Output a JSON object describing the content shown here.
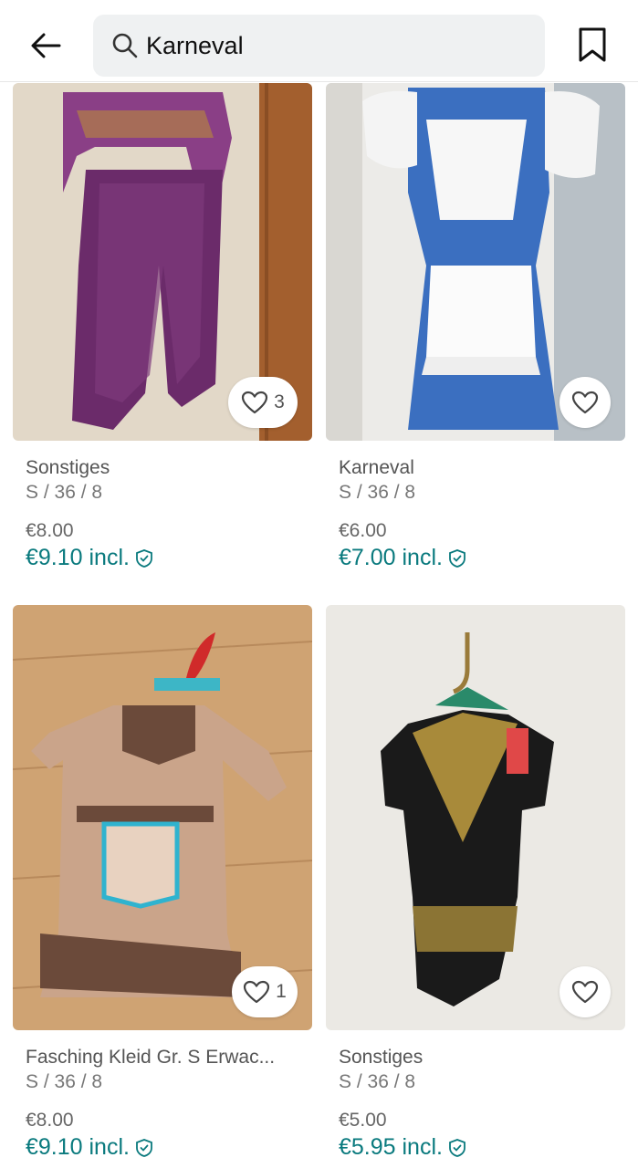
{
  "header": {
    "back_icon": "arrow-left-icon",
    "search_value": "Karneval",
    "search_icon": "search-icon",
    "save_icon": "bookmark-icon"
  },
  "colors": {
    "accent": "#0a7a7e"
  },
  "items": [
    {
      "brand": "Sonstiges",
      "size": "S / 36 / 8",
      "price": "€8.00",
      "price_incl": "€9.10 incl.",
      "favorites": "3"
    },
    {
      "brand": "Karneval",
      "size": "S / 36 / 8",
      "price": "€6.00",
      "price_incl": "€7.00 incl.",
      "favorites": ""
    },
    {
      "brand": "Fasching Kleid Gr. S Erwac...",
      "size": "S / 36 / 8",
      "price": "€8.00",
      "price_incl": "€9.10 incl.",
      "favorites": "1"
    },
    {
      "brand": "Sonstiges",
      "size": "S / 36 / 8",
      "price": "€5.00",
      "price_incl": "€5.95 incl.",
      "favorites": ""
    }
  ]
}
